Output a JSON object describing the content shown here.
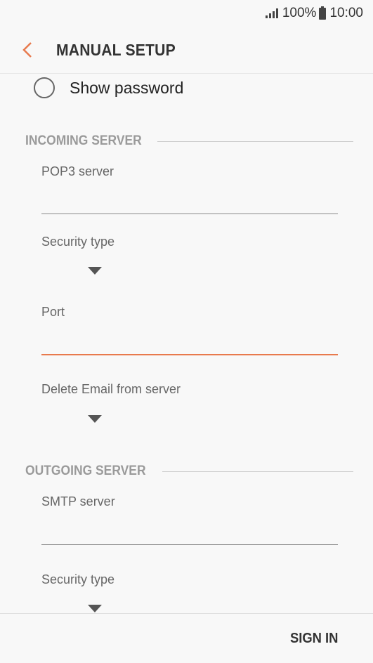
{
  "status_bar": {
    "battery": "100%",
    "time": "10:00"
  },
  "header": {
    "title": "MANUAL SETUP"
  },
  "show_password": {
    "label": "Show password",
    "checked": false
  },
  "incoming": {
    "header": "INCOMING SERVER",
    "server_label": "POP3 server",
    "server_value": "",
    "security_label": "Security type",
    "security_value": "",
    "port_label": "Port",
    "port_value": "",
    "delete_label": "Delete Email from server",
    "delete_value": ""
  },
  "outgoing": {
    "header": "OUTGOING SERVER",
    "server_label": "SMTP server",
    "server_value": "",
    "security_label": "Security type",
    "security_value": ""
  },
  "footer": {
    "sign_in": "SIGN IN"
  },
  "colors": {
    "accent": "#e87a4d",
    "section_header": "#9a9a9a",
    "background": "#f8f8f8"
  }
}
